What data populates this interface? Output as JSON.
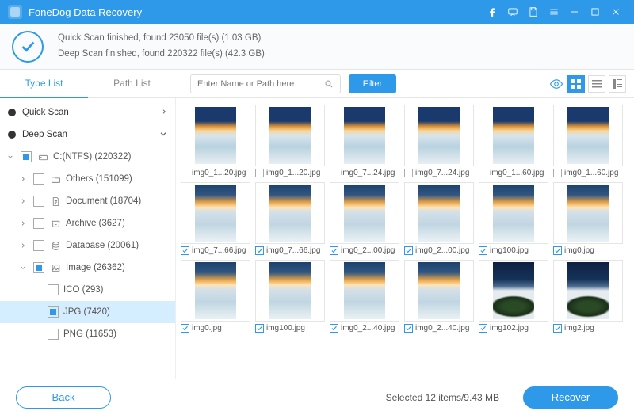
{
  "app": {
    "title": "FoneDog Data Recovery"
  },
  "status": {
    "quick": "Quick Scan finished, found 23050 file(s) (1.03 GB)",
    "deep": "Deep Scan finished, found 220322 file(s) (42.3 GB)"
  },
  "tabs": {
    "type": "Type List",
    "path": "Path List"
  },
  "search": {
    "placeholder": "Enter Name or Path here"
  },
  "filter": "Filter",
  "tree": {
    "quick": "Quick Scan",
    "deep": "Deep Scan",
    "drive": "C:(NTFS) (220322)",
    "others": "Others (151099)",
    "document": "Document (18704)",
    "archive": "Archive (3627)",
    "database": "Database (20061)",
    "image": "Image (26362)",
    "ico": "ICO (293)",
    "jpg": "JPG (7420)",
    "png": "PNG (11653)"
  },
  "files": {
    "r0": [
      "img0_1...20.jpg",
      "img0_1...20.jpg",
      "img0_7...24.jpg",
      "img0_7...24.jpg",
      "img0_1...60.jpg",
      "img0_1...60.jpg"
    ],
    "r1": [
      "img0_7...66.jpg",
      "img0_7...66.jpg",
      "img0_2...00.jpg",
      "img0_2...00.jpg",
      "img100.jpg",
      "img0.jpg"
    ],
    "r2": [
      "img0.jpg",
      "img100.jpg",
      "img0_2...40.jpg",
      "img0_2...40.jpg",
      "img102.jpg",
      "img2.jpg"
    ]
  },
  "footer": {
    "back": "Back",
    "selected": "Selected 12 items/9.43 MB",
    "recover": "Recover"
  }
}
